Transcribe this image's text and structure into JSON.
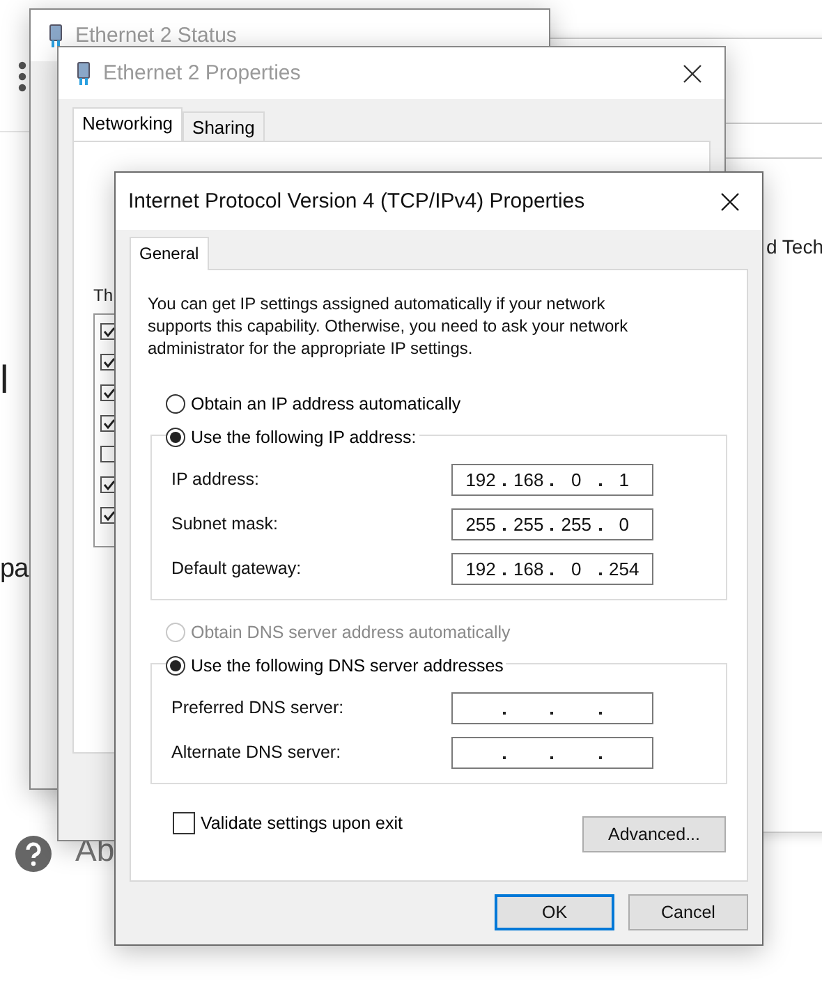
{
  "background_page": {
    "fragments": [
      {
        "text": "l",
        "muted": false
      },
      {
        "text": "pa",
        "muted": false
      },
      {
        "text": "Ab",
        "muted": true
      },
      {
        "text": "d Tech",
        "muted": false
      }
    ]
  },
  "status_window": {
    "title": "Ethernet 2 Status"
  },
  "properties_window": {
    "title": "Ethernet 2 Properties",
    "tabs": [
      {
        "label": "Networking",
        "selected": true
      },
      {
        "label": "Sharing",
        "selected": false
      }
    ],
    "list_caption": "Th",
    "items": [
      {
        "checked": true
      },
      {
        "checked": true
      },
      {
        "checked": true
      },
      {
        "checked": true
      },
      {
        "checked": false
      },
      {
        "checked": true
      },
      {
        "checked": true
      }
    ]
  },
  "ipv4_dialog": {
    "title": "Internet Protocol Version 4 (TCP/IPv4) Properties",
    "tabs": [
      {
        "label": "General",
        "selected": true
      }
    ],
    "intro": "You can get IP settings assigned automatically if your network supports this capability. Otherwise, you need to ask your network administrator for the appropriate IP settings.",
    "ip_options": [
      {
        "label": "Obtain an IP address automatically",
        "selected": false
      },
      {
        "label": "Use the following IP address:",
        "selected": true
      }
    ],
    "ip_fields": [
      {
        "label": "IP address:",
        "octets": [
          "192",
          "168",
          "0",
          "1"
        ]
      },
      {
        "label": "Subnet mask:",
        "octets": [
          "255",
          "255",
          "255",
          "0"
        ]
      },
      {
        "label": "Default gateway:",
        "octets": [
          "192",
          "168",
          "0",
          "254"
        ]
      }
    ],
    "dns_options": [
      {
        "label": "Obtain DNS server address automatically",
        "selected": false,
        "disabled": true
      },
      {
        "label": "Use the following DNS server addresses",
        "selected": true,
        "disabled": false
      }
    ],
    "dns_fields": [
      {
        "label": "Preferred DNS server:"
      },
      {
        "label": "Alternate DNS server:"
      }
    ],
    "validate": {
      "label": "Validate settings upon exit",
      "checked": false
    },
    "advanced_button": "Advanced...",
    "buttons": [
      {
        "label": "OK",
        "default": true
      },
      {
        "label": "Cancel",
        "default": false
      }
    ]
  }
}
